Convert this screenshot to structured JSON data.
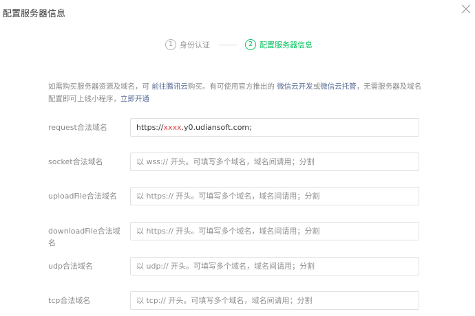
{
  "dialog": {
    "title": "配置服务器信息"
  },
  "steps": [
    {
      "number": "1",
      "label": "身份认证",
      "state": "done"
    },
    {
      "number": "2",
      "label": "配置服务器信息",
      "state": "active"
    }
  ],
  "notice": {
    "text1": "如需购买服务器资源及域名，可",
    "link_buy": "前往腾讯云",
    "text2": "购买。有可使用官方推出的",
    "link_cloud_dev": "微信云开发",
    "text3": "或",
    "link_cloud_host": "微信云托管",
    "text4": "，无需服务器及域名配置即可上线小程序，",
    "link_open": "立即开通"
  },
  "form": {
    "request": {
      "label": "request合法域名",
      "value_prefix": "https://",
      "value_masked": "xxxx",
      "value_suffix": ".y0.udiansoft.com;"
    },
    "socket": {
      "label": "socket合法域名",
      "placeholder": "以 wss:// 开头。可填写多个域名，域名间请用；分割"
    },
    "uploadFile": {
      "label": "uploadFile合法域名",
      "placeholder": "以 https:// 开头。可填写多个域名，域名间请用；分割"
    },
    "downloadFile": {
      "label": "downloadFile合法域名",
      "placeholder": "以 https:// 开头。可填写多个域名，域名间请用；分割"
    },
    "udp": {
      "label": "udp合法域名",
      "placeholder": "以 udp:// 开头。可填写多个域名，域名间请用；分割"
    },
    "tcp": {
      "label": "tcp合法域名",
      "placeholder": "以 tcp:// 开头。可填写多个域名，域名间请用；分割"
    }
  },
  "colors": {
    "accent_green": "#07c160",
    "link_blue": "#576b95",
    "masked_red": "#e64340"
  },
  "icons": {
    "close": "close-icon"
  }
}
